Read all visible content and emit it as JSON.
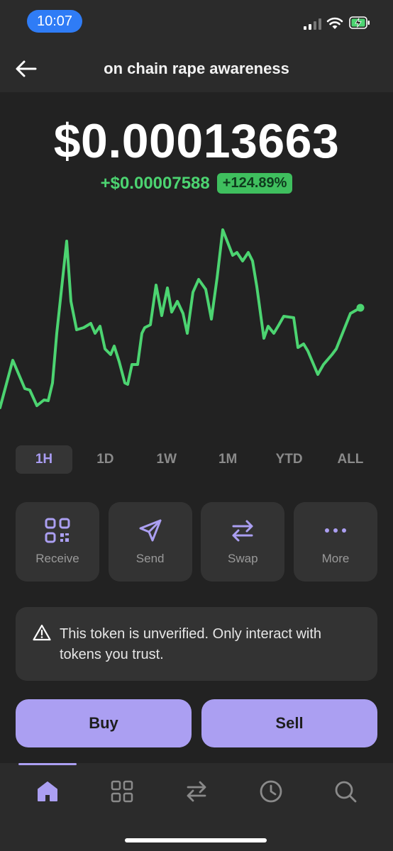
{
  "status_bar": {
    "time": "10:07"
  },
  "header": {
    "title": "on chain rape awareness"
  },
  "price": {
    "value": "$0.00013663",
    "change_amount": "+$0.00007588",
    "change_percent": "+124.89%"
  },
  "ranges": [
    {
      "label": "1H",
      "active": true
    },
    {
      "label": "1D",
      "active": false
    },
    {
      "label": "1W",
      "active": false
    },
    {
      "label": "1M",
      "active": false
    },
    {
      "label": "YTD",
      "active": false
    },
    {
      "label": "ALL",
      "active": false
    }
  ],
  "actions": [
    {
      "label": "Receive",
      "icon": "qr-code-icon"
    },
    {
      "label": "Send",
      "icon": "send-icon"
    },
    {
      "label": "Swap",
      "icon": "swap-icon"
    },
    {
      "label": "More",
      "icon": "more-icon"
    }
  ],
  "warning": {
    "text": "This token is unverified. Only interact with tokens you trust."
  },
  "trade": {
    "buy_label": "Buy",
    "sell_label": "Sell"
  },
  "colors": {
    "accent": "#ab9ff2",
    "positive": "#4cd471",
    "background": "#222222"
  }
}
